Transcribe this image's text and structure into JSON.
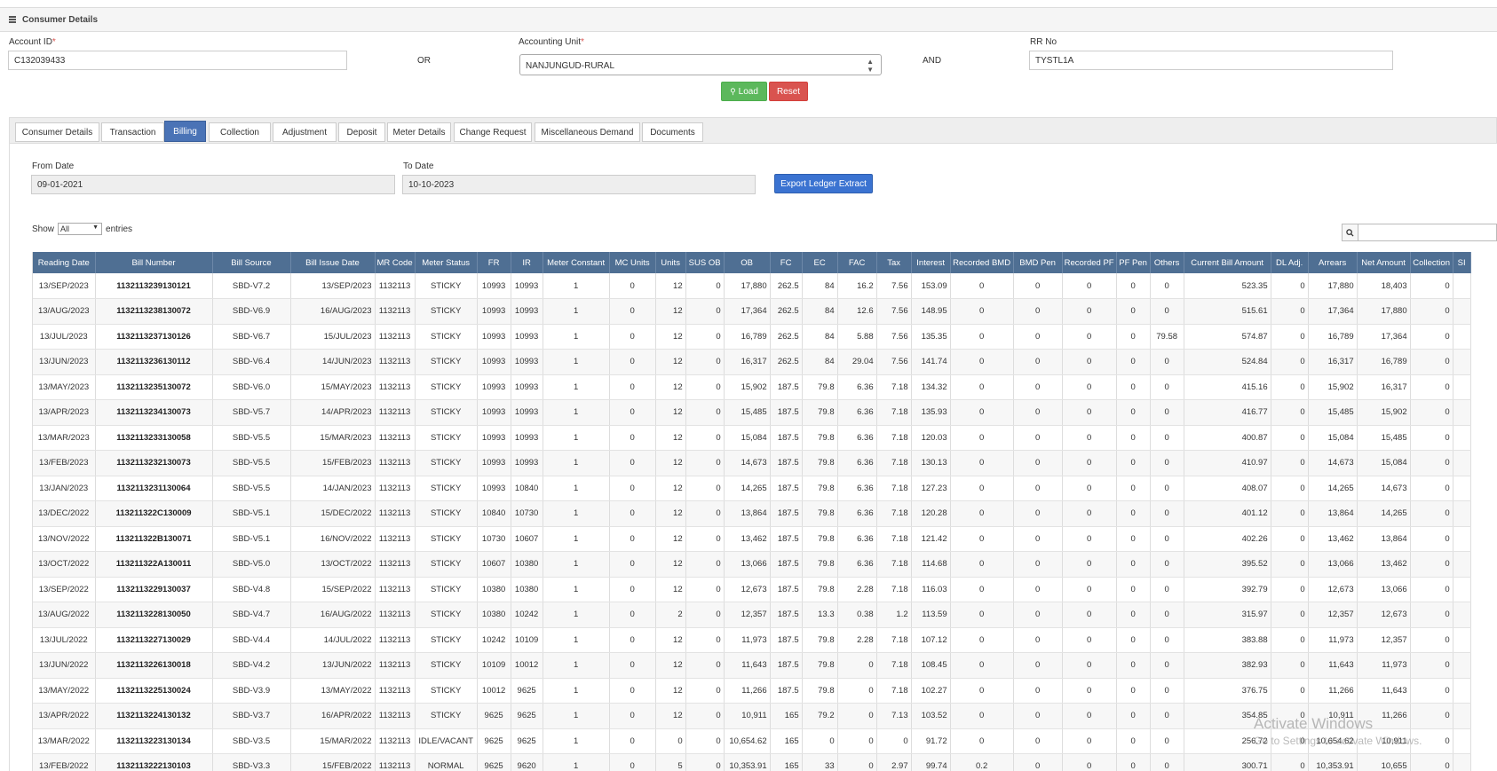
{
  "panel": {
    "title": "Consumer Details"
  },
  "form": {
    "account_id_label": "Account ID",
    "account_id_value": "C132039433",
    "or_label": "OR",
    "accounting_unit_label": "Accounting Unit",
    "accounting_unit_value": "NANJUNGUD-RURAL",
    "and_label": "AND",
    "rr_no_label": "RR No",
    "rr_no_value": "TYSTL1A",
    "required_mark": "*",
    "load_label": "Load",
    "reset_label": "Reset"
  },
  "tabs": [
    "Consumer Details",
    "Transaction",
    "Billing",
    "Collection",
    "Adjustment",
    "Deposit",
    "Meter Details",
    "Change Request",
    "Miscellaneous Demand",
    "Documents"
  ],
  "active_tab": "Billing",
  "billing": {
    "from_date_label": "From Date",
    "from_date_value": "09-01-2021",
    "to_date_label": "To Date",
    "to_date_value": "10-10-2023",
    "export_label": "Export Ledger Extract",
    "show_label": "Show",
    "show_value": "All",
    "entries_label": "entries"
  },
  "table": {
    "columns": [
      "Reading Date",
      "Bill Number",
      "Bill Source",
      "Bill Issue Date",
      "MR Code",
      "Meter Status",
      "FR",
      "IR",
      "Meter Constant",
      "MC Units",
      "Units",
      "SUS OB",
      "OB",
      "FC",
      "EC",
      "FAC",
      "Tax",
      "Interest",
      "Recorded BMD",
      "BMD Pen",
      "Recorded PF",
      "PF Pen",
      "Others",
      "Current Bill Amount",
      "DL Adj.",
      "Arrears",
      "Net Amount",
      "Collection",
      "SI"
    ],
    "rows": [
      [
        "13/SEP/2023",
        "1132113239130121",
        "SBD-V7.2",
        "13/SEP/2023",
        "1132113",
        "STICKY",
        "10993",
        "10993",
        "1",
        "0",
        "12",
        "0",
        "17,880",
        "262.5",
        "84",
        "16.2",
        "7.56",
        "153.09",
        "0",
        "0",
        "0",
        "0",
        "0",
        "523.35",
        "0",
        "17,880",
        "18,403",
        "0",
        ""
      ],
      [
        "13/AUG/2023",
        "1132113238130072",
        "SBD-V6.9",
        "16/AUG/2023",
        "1132113",
        "STICKY",
        "10993",
        "10993",
        "1",
        "0",
        "12",
        "0",
        "17,364",
        "262.5",
        "84",
        "12.6",
        "7.56",
        "148.95",
        "0",
        "0",
        "0",
        "0",
        "0",
        "515.61",
        "0",
        "17,364",
        "17,880",
        "0",
        ""
      ],
      [
        "13/JUL/2023",
        "1132113237130126",
        "SBD-V6.7",
        "15/JUL/2023",
        "1132113",
        "STICKY",
        "10993",
        "10993",
        "1",
        "0",
        "12",
        "0",
        "16,789",
        "262.5",
        "84",
        "5.88",
        "7.56",
        "135.35",
        "0",
        "0",
        "0",
        "0",
        "79.58",
        "574.87",
        "0",
        "16,789",
        "17,364",
        "0",
        ""
      ],
      [
        "13/JUN/2023",
        "1132113236130112",
        "SBD-V6.4",
        "14/JUN/2023",
        "1132113",
        "STICKY",
        "10993",
        "10993",
        "1",
        "0",
        "12",
        "0",
        "16,317",
        "262.5",
        "84",
        "29.04",
        "7.56",
        "141.74",
        "0",
        "0",
        "0",
        "0",
        "0",
        "524.84",
        "0",
        "16,317",
        "16,789",
        "0",
        ""
      ],
      [
        "13/MAY/2023",
        "1132113235130072",
        "SBD-V6.0",
        "15/MAY/2023",
        "1132113",
        "STICKY",
        "10993",
        "10993",
        "1",
        "0",
        "12",
        "0",
        "15,902",
        "187.5",
        "79.8",
        "6.36",
        "7.18",
        "134.32",
        "0",
        "0",
        "0",
        "0",
        "0",
        "415.16",
        "0",
        "15,902",
        "16,317",
        "0",
        ""
      ],
      [
        "13/APR/2023",
        "1132113234130073",
        "SBD-V5.7",
        "14/APR/2023",
        "1132113",
        "STICKY",
        "10993",
        "10993",
        "1",
        "0",
        "12",
        "0",
        "15,485",
        "187.5",
        "79.8",
        "6.36",
        "7.18",
        "135.93",
        "0",
        "0",
        "0",
        "0",
        "0",
        "416.77",
        "0",
        "15,485",
        "15,902",
        "0",
        ""
      ],
      [
        "13/MAR/2023",
        "1132113233130058",
        "SBD-V5.5",
        "15/MAR/2023",
        "1132113",
        "STICKY",
        "10993",
        "10993",
        "1",
        "0",
        "12",
        "0",
        "15,084",
        "187.5",
        "79.8",
        "6.36",
        "7.18",
        "120.03",
        "0",
        "0",
        "0",
        "0",
        "0",
        "400.87",
        "0",
        "15,084",
        "15,485",
        "0",
        ""
      ],
      [
        "13/FEB/2023",
        "1132113232130073",
        "SBD-V5.5",
        "15/FEB/2023",
        "1132113",
        "STICKY",
        "10993",
        "10993",
        "1",
        "0",
        "12",
        "0",
        "14,673",
        "187.5",
        "79.8",
        "6.36",
        "7.18",
        "130.13",
        "0",
        "0",
        "0",
        "0",
        "0",
        "410.97",
        "0",
        "14,673",
        "15,084",
        "0",
        ""
      ],
      [
        "13/JAN/2023",
        "1132113231130064",
        "SBD-V5.5",
        "14/JAN/2023",
        "1132113",
        "STICKY",
        "10993",
        "10840",
        "1",
        "0",
        "12",
        "0",
        "14,265",
        "187.5",
        "79.8",
        "6.36",
        "7.18",
        "127.23",
        "0",
        "0",
        "0",
        "0",
        "0",
        "408.07",
        "0",
        "14,265",
        "14,673",
        "0",
        ""
      ],
      [
        "13/DEC/2022",
        "113211322C130009",
        "SBD-V5.1",
        "15/DEC/2022",
        "1132113",
        "STICKY",
        "10840",
        "10730",
        "1",
        "0",
        "12",
        "0",
        "13,864",
        "187.5",
        "79.8",
        "6.36",
        "7.18",
        "120.28",
        "0",
        "0",
        "0",
        "0",
        "0",
        "401.12",
        "0",
        "13,864",
        "14,265",
        "0",
        ""
      ],
      [
        "13/NOV/2022",
        "113211322B130071",
        "SBD-V5.1",
        "16/NOV/2022",
        "1132113",
        "STICKY",
        "10730",
        "10607",
        "1",
        "0",
        "12",
        "0",
        "13,462",
        "187.5",
        "79.8",
        "6.36",
        "7.18",
        "121.42",
        "0",
        "0",
        "0",
        "0",
        "0",
        "402.26",
        "0",
        "13,462",
        "13,864",
        "0",
        ""
      ],
      [
        "13/OCT/2022",
        "113211322A130011",
        "SBD-V5.0",
        "13/OCT/2022",
        "1132113",
        "STICKY",
        "10607",
        "10380",
        "1",
        "0",
        "12",
        "0",
        "13,066",
        "187.5",
        "79.8",
        "6.36",
        "7.18",
        "114.68",
        "0",
        "0",
        "0",
        "0",
        "0",
        "395.52",
        "0",
        "13,066",
        "13,462",
        "0",
        ""
      ],
      [
        "13/SEP/2022",
        "1132113229130037",
        "SBD-V4.8",
        "15/SEP/2022",
        "1132113",
        "STICKY",
        "10380",
        "10380",
        "1",
        "0",
        "12",
        "0",
        "12,673",
        "187.5",
        "79.8",
        "2.28",
        "7.18",
        "116.03",
        "0",
        "0",
        "0",
        "0",
        "0",
        "392.79",
        "0",
        "12,673",
        "13,066",
        "0",
        ""
      ],
      [
        "13/AUG/2022",
        "1132113228130050",
        "SBD-V4.7",
        "16/AUG/2022",
        "1132113",
        "STICKY",
        "10380",
        "10242",
        "1",
        "0",
        "2",
        "0",
        "12,357",
        "187.5",
        "13.3",
        "0.38",
        "1.2",
        "113.59",
        "0",
        "0",
        "0",
        "0",
        "0",
        "315.97",
        "0",
        "12,357",
        "12,673",
        "0",
        ""
      ],
      [
        "13/JUL/2022",
        "1132113227130029",
        "SBD-V4.4",
        "14/JUL/2022",
        "1132113",
        "STICKY",
        "10242",
        "10109",
        "1",
        "0",
        "12",
        "0",
        "11,973",
        "187.5",
        "79.8",
        "2.28",
        "7.18",
        "107.12",
        "0",
        "0",
        "0",
        "0",
        "0",
        "383.88",
        "0",
        "11,973",
        "12,357",
        "0",
        ""
      ],
      [
        "13/JUN/2022",
        "1132113226130018",
        "SBD-V4.2",
        "13/JUN/2022",
        "1132113",
        "STICKY",
        "10109",
        "10012",
        "1",
        "0",
        "12",
        "0",
        "11,643",
        "187.5",
        "79.8",
        "0",
        "7.18",
        "108.45",
        "0",
        "0",
        "0",
        "0",
        "0",
        "382.93",
        "0",
        "11,643",
        "11,973",
        "0",
        ""
      ],
      [
        "13/MAY/2022",
        "1132113225130024",
        "SBD-V3.9",
        "13/MAY/2022",
        "1132113",
        "STICKY",
        "10012",
        "9625",
        "1",
        "0",
        "12",
        "0",
        "11,266",
        "187.5",
        "79.8",
        "0",
        "7.18",
        "102.27",
        "0",
        "0",
        "0",
        "0",
        "0",
        "376.75",
        "0",
        "11,266",
        "11,643",
        "0",
        ""
      ],
      [
        "13/APR/2022",
        "1132113224130132",
        "SBD-V3.7",
        "16/APR/2022",
        "1132113",
        "STICKY",
        "9625",
        "9625",
        "1",
        "0",
        "12",
        "0",
        "10,911",
        "165",
        "79.2",
        "0",
        "7.13",
        "103.52",
        "0",
        "0",
        "0",
        "0",
        "0",
        "354.85",
        "0",
        "10,911",
        "11,266",
        "0",
        ""
      ],
      [
        "13/MAR/2022",
        "1132113223130134",
        "SBD-V3.5",
        "15/MAR/2022",
        "1132113",
        "IDLE/VACANT",
        "9625",
        "9625",
        "1",
        "0",
        "0",
        "0",
        "10,654.62",
        "165",
        "0",
        "0",
        "0",
        "91.72",
        "0",
        "0",
        "0",
        "0",
        "0",
        "256.72",
        "0",
        "10,654.62",
        "10,911",
        "0",
        ""
      ],
      [
        "13/FEB/2022",
        "1132113222130103",
        "SBD-V3.3",
        "15/FEB/2022",
        "1132113",
        "NORMAL",
        "9625",
        "9620",
        "1",
        "0",
        "5",
        "0",
        "10,353.91",
        "165",
        "33",
        "0",
        "2.97",
        "99.74",
        "0.2",
        "0",
        "0",
        "0",
        "0",
        "300.71",
        "0",
        "10,353.91",
        "10,655",
        "0",
        ""
      ]
    ]
  },
  "watermark": {
    "line1": "Activate Windows",
    "line2": "Go to Settings to activate Windows."
  },
  "icons": {
    "menu": "hamburger-icon",
    "load": "search-icon",
    "search": "search-icon",
    "caret": "chevron-down-icon"
  },
  "colors": {
    "header_bg": "#4f6f93",
    "active_tab": "#4a73b6",
    "load": "#5cb85c",
    "reset": "#d9534f",
    "export": "#3b73d1"
  }
}
